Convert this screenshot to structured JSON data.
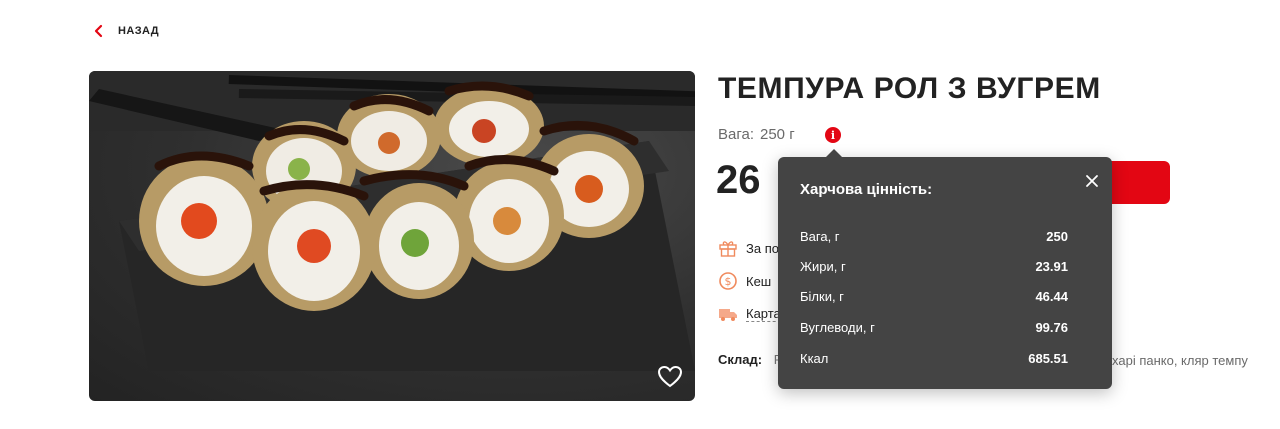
{
  "nav": {
    "back_label": "НАЗАД"
  },
  "product": {
    "title": "ТЕМПУРА РОЛ З ВУГРЕМ",
    "weight_label": "Вага:",
    "weight_value": "250 г",
    "price_partial": "26",
    "features": [
      "За по",
      "Кеш",
      "Карта"
    ],
    "composition_label": "Склад:",
    "composition_visible_fragment": "Р",
    "composition_tail": "сухарі панко, кляр темпу"
  },
  "nutrition_popup": {
    "title": "Харчова цінність:",
    "rows": [
      {
        "label": "Вага, г",
        "value": "250"
      },
      {
        "label": "Жири, г",
        "value": "23.91"
      },
      {
        "label": "Білки, г",
        "value": "46.44"
      },
      {
        "label": "Вуглеводи, г",
        "value": "99.76"
      },
      {
        "label": "Ккал",
        "value": "685.51"
      }
    ]
  },
  "colors": {
    "accent": "#e30613",
    "popup_bg": "#444444",
    "text": "#222222"
  },
  "icons": [
    "chevron-left-icon",
    "info-icon",
    "heart-icon",
    "gift-icon",
    "cashback-icon",
    "delivery-truck-icon",
    "close-icon"
  ]
}
